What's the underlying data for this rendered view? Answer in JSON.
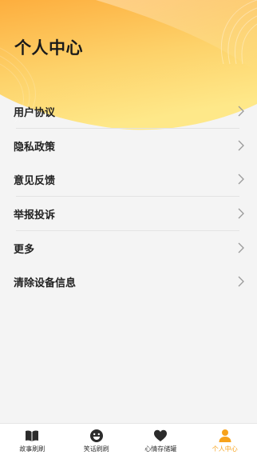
{
  "page": {
    "title": "个人中心"
  },
  "colors": {
    "accent": "#f7a21b",
    "header_top": "#fdb64a",
    "header_bottom": "#fde683",
    "background": "#f4f4f4"
  },
  "menu": {
    "items": [
      {
        "label": "用户协议"
      },
      {
        "label": "隐私政策"
      },
      {
        "label": "意见反馈"
      },
      {
        "label": "举报投诉"
      },
      {
        "label": "更多"
      },
      {
        "label": "清除设备信息"
      }
    ]
  },
  "tabbar": {
    "tabs": [
      {
        "label": "故事刷刷",
        "icon": "book-icon",
        "active": false
      },
      {
        "label": "笑话刷刷",
        "icon": "smiley-icon",
        "active": false
      },
      {
        "label": "心情存储罐",
        "icon": "heart-icon",
        "active": false
      },
      {
        "label": "个人中心",
        "icon": "person-icon",
        "active": true
      }
    ]
  }
}
